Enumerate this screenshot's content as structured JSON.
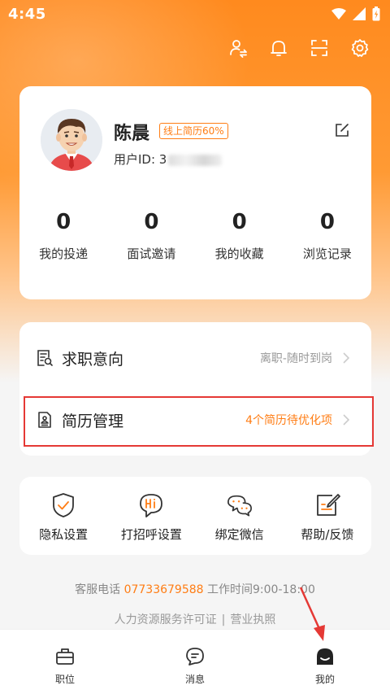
{
  "status_bar": {
    "time": "4:45"
  },
  "profile": {
    "name": "陈晨",
    "resume_badge": "线上简历60%",
    "user_id_prefix": "用户ID: 3"
  },
  "stats": [
    {
      "value": "0",
      "label": "我的投递"
    },
    {
      "value": "0",
      "label": "面试邀请"
    },
    {
      "value": "0",
      "label": "我的收藏"
    },
    {
      "value": "0",
      "label": "浏览记录"
    }
  ],
  "menu": {
    "job_intention": {
      "label": "求职意向",
      "value": "离职-随时到岗"
    },
    "resume_management": {
      "label": "简历管理",
      "value": "4个简历待优化项"
    }
  },
  "tools": [
    {
      "label": "隐私设置",
      "icon": "shield-check-icon"
    },
    {
      "label": "打招呼设置",
      "icon": "hi-bubble-icon"
    },
    {
      "label": "绑定微信",
      "icon": "wechat-icon"
    },
    {
      "label": "帮助/反馈",
      "icon": "edit-note-icon"
    }
  ],
  "service": {
    "phone_label": "客服电话",
    "phone": "07733679588",
    "hours": "工作时间9:00-18:00"
  },
  "links": {
    "license": "人力资源服务许可证",
    "separator": "|",
    "business": "营业执照"
  },
  "tabs": [
    {
      "label": "职位",
      "icon": "briefcase-icon"
    },
    {
      "label": "消息",
      "icon": "chat-icon"
    },
    {
      "label": "我的",
      "icon": "profile-face-icon"
    }
  ],
  "colors": {
    "brand_orange": "#ff7d14",
    "highlight_red": "#e53935"
  }
}
